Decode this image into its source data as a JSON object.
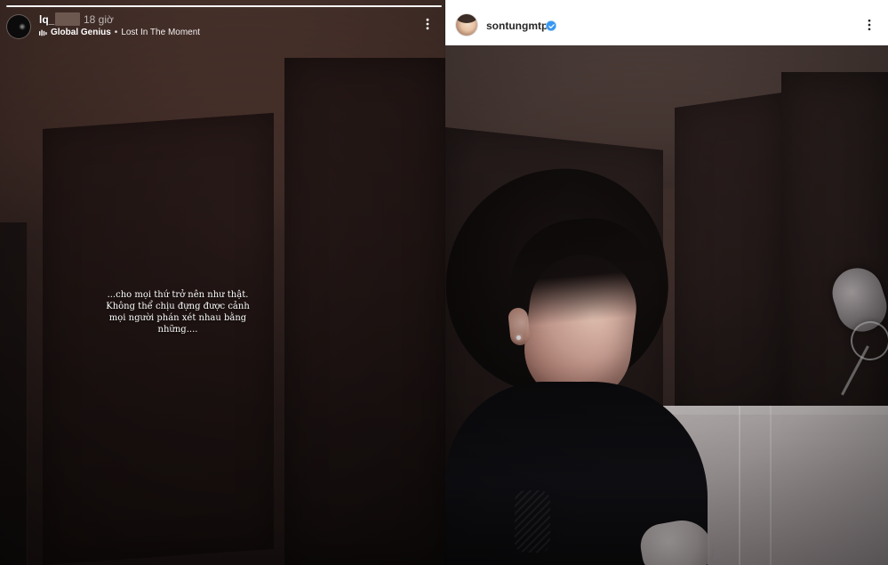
{
  "left_story": {
    "progress": 1.0,
    "username": "lq_",
    "time_ago": "18 giờ",
    "music": {
      "icon": "music-wave-icon",
      "artist": "Global Genius",
      "separator": "•",
      "song": "Lost In The Moment"
    },
    "caption_lines": [
      "...cho mọi thứ trở nên như thật.",
      "Không thể chịu đựng được cảnh",
      "mọi người phán xét nhau bằng",
      "những...."
    ],
    "more_icon": "more-vertical-icon"
  },
  "right_post": {
    "username": "sontungmtp",
    "verified_icon": "verified-badge-icon",
    "more_icon": "more-vertical-icon"
  },
  "colors": {
    "instagram_blue": "#3897f0",
    "header_text": "#262626",
    "story_text": "#ffffff"
  }
}
